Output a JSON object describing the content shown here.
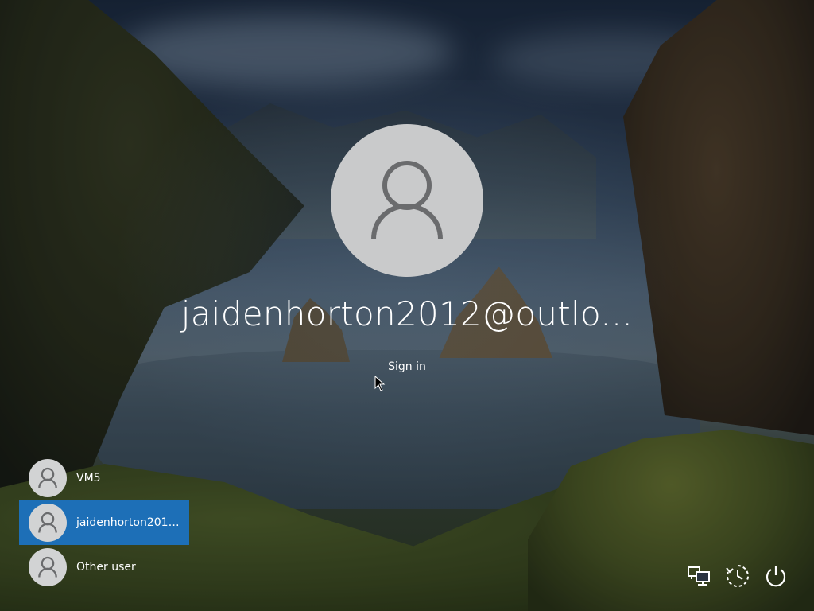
{
  "login": {
    "display_name": "jaidenhorton2012@outlo...",
    "sign_in_label": "Sign in"
  },
  "users": [
    {
      "name": "VM5",
      "selected": false
    },
    {
      "name": "jaidenhorton2012...",
      "selected": true
    },
    {
      "name": "Other user",
      "selected": false
    }
  ],
  "system_icons": {
    "network": "network-icon",
    "accessibility": "ease-of-access-icon",
    "power": "power-icon"
  },
  "colors": {
    "selected_user": "#1d6fb7",
    "avatar_bg": "#c9cacb",
    "avatar_glyph": "#6a6b6d"
  }
}
